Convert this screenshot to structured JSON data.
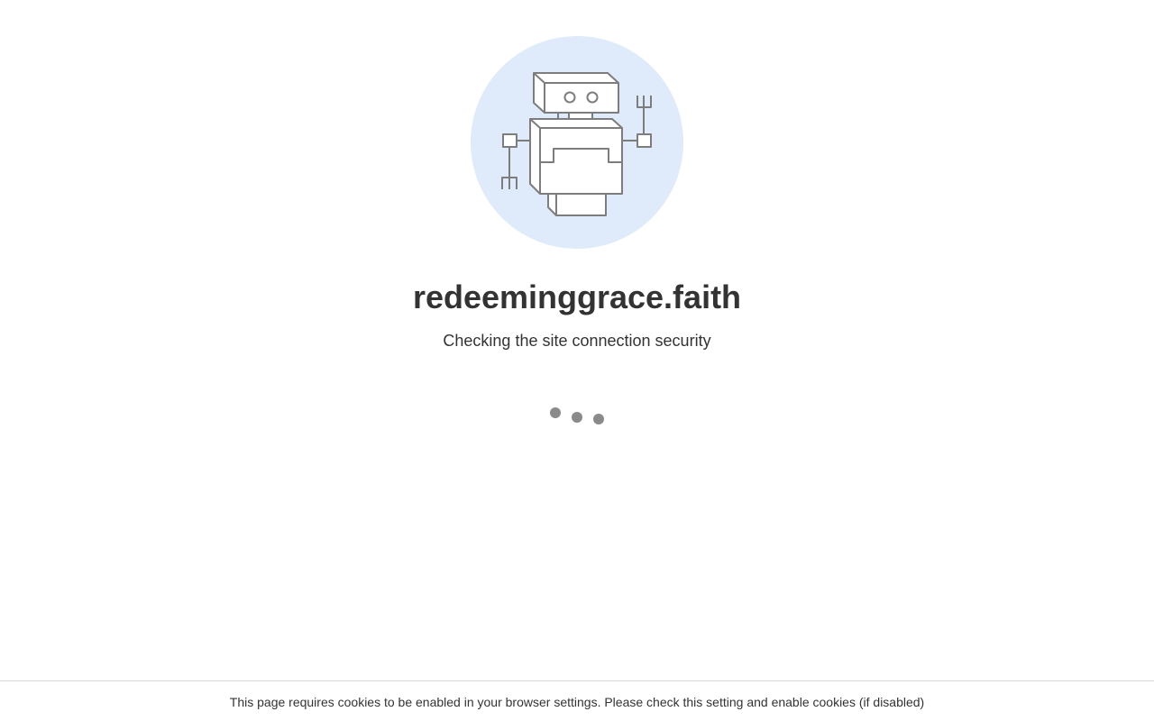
{
  "site": {
    "domain": "redeeminggrace.faith",
    "status": "Checking the site connection security"
  },
  "footer": {
    "cookie_notice": "This page requires cookies to be enabled in your browser settings. Please check this setting and enable cookies (if disabled)"
  },
  "illustration": {
    "icon": "robot-icon",
    "background_color": "#dfeafa",
    "line_color": "#7d7d7d"
  },
  "loader": {
    "icon": "loading-dots-icon",
    "dot_color": "#8a8a8a"
  }
}
